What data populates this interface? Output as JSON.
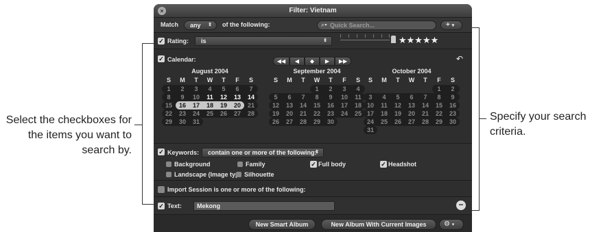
{
  "window": {
    "title": "Filter: Vietnam"
  },
  "match_row": {
    "prefix": "Match",
    "mode": "any",
    "suffix": "of the following:",
    "search_placeholder": "Quick Search...",
    "add_label": "+"
  },
  "rating": {
    "label": "Rating:",
    "operator": "is",
    "stars": "★★★★★",
    "checked": true
  },
  "calendar": {
    "label": "Calendar:",
    "checked": true,
    "nav": [
      "◀◀",
      "◀",
      "◆",
      "▶",
      "▶▶"
    ],
    "months": [
      {
        "name": "August 2004",
        "dow": [
          "S",
          "M",
          "T",
          "W",
          "T",
          "F",
          "S"
        ],
        "weeks": [
          [
            "1",
            "2",
            "3",
            "4",
            "5",
            "6",
            "7"
          ],
          [
            "8",
            "9",
            "10",
            "11",
            "12",
            "13",
            "14"
          ],
          [
            "15",
            "16",
            "17",
            "18",
            "19",
            "20",
            "21"
          ],
          [
            "22",
            "23",
            "24",
            "25",
            "26",
            "27",
            "28"
          ],
          [
            "29",
            "30",
            "31",
            "",
            "",
            "",
            ""
          ]
        ]
      },
      {
        "name": "September 2004",
        "dow": [
          "S",
          "M",
          "T",
          "W",
          "T",
          "F",
          "S"
        ],
        "weeks": [
          [
            "",
            "",
            "",
            "1",
            "2",
            "3",
            "4"
          ],
          [
            "5",
            "6",
            "7",
            "8",
            "9",
            "10",
            "11"
          ],
          [
            "12",
            "13",
            "14",
            "15",
            "16",
            "17",
            "18"
          ],
          [
            "19",
            "20",
            "21",
            "22",
            "23",
            "24",
            "25"
          ],
          [
            "26",
            "27",
            "28",
            "29",
            "30",
            "",
            ""
          ]
        ]
      },
      {
        "name": "October 2004",
        "dow": [
          "S",
          "M",
          "T",
          "W",
          "T",
          "F",
          "S"
        ],
        "weeks": [
          [
            "",
            "",
            "",
            "",
            "",
            "1",
            "2"
          ],
          [
            "3",
            "4",
            "5",
            "6",
            "7",
            "8",
            "9"
          ],
          [
            "10",
            "11",
            "12",
            "13",
            "14",
            "15",
            "16"
          ],
          [
            "17",
            "18",
            "19",
            "20",
            "21",
            "22",
            "23"
          ],
          [
            "24",
            "25",
            "26",
            "27",
            "28",
            "29",
            "30"
          ],
          [
            "31",
            "",
            "",
            "",
            "",
            "",
            ""
          ]
        ]
      }
    ]
  },
  "keywords": {
    "label": "Keywords:",
    "operator": "contain one or more of the following:",
    "checked": true,
    "options": [
      {
        "label": "Background",
        "checked": false
      },
      {
        "label": "Family",
        "checked": false
      },
      {
        "label": "Full body",
        "checked": true
      },
      {
        "label": "Headshot",
        "checked": true
      },
      {
        "label": "Landscape (Image typ",
        "checked": false
      },
      {
        "label": "Silhouette",
        "checked": false
      }
    ]
  },
  "import_session": {
    "label": "Import Session is one or more of the following:",
    "checked": false
  },
  "text": {
    "label": "Text:",
    "value": "Mekong",
    "checked": true
  },
  "buttons": {
    "new_smart_album": "New Smart Album",
    "new_album_current": "New Album With Current Images"
  },
  "callouts": {
    "left": "Select the checkboxes for the items you want to search by.",
    "right": "Specify your search criteria."
  }
}
